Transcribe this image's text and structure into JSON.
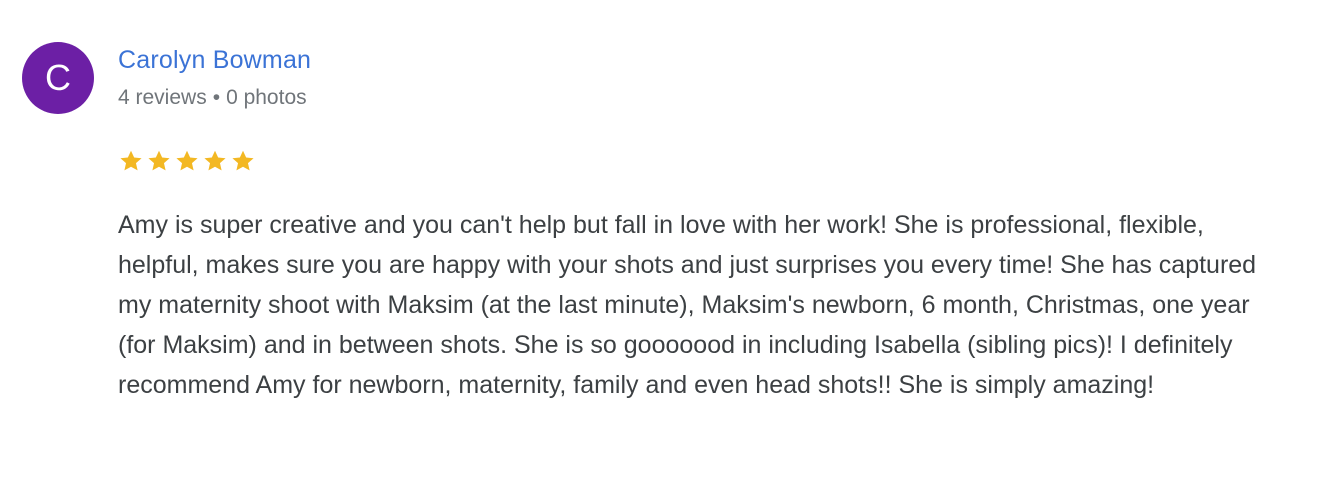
{
  "review": {
    "avatar_initial": "C",
    "reviewer_name": "Carolyn Bowman",
    "reviews_count": "4 reviews",
    "separator": "•",
    "photos_count": "0 photos",
    "rating": 5,
    "rating_max": 5,
    "star_icon": "star-icon",
    "star_color": "#f3b823",
    "avatar_color": "#6c1fa5",
    "name_color": "#3b73d6",
    "text": "Amy is super creative and you can't help but fall in love with her work! She is professional, flexible, helpful, makes sure you are happy with your shots and just surprises you every time! She has captured my maternity shoot with Maksim (at the last minute), Maksim's newborn, 6 month, Christmas, one year (for Maksim) and in between shots. She is so gooooood in including Isabella (sibling pics)! I definitely recommend Amy for newborn, maternity, family and even head shots!! She is simply amazing!"
  }
}
